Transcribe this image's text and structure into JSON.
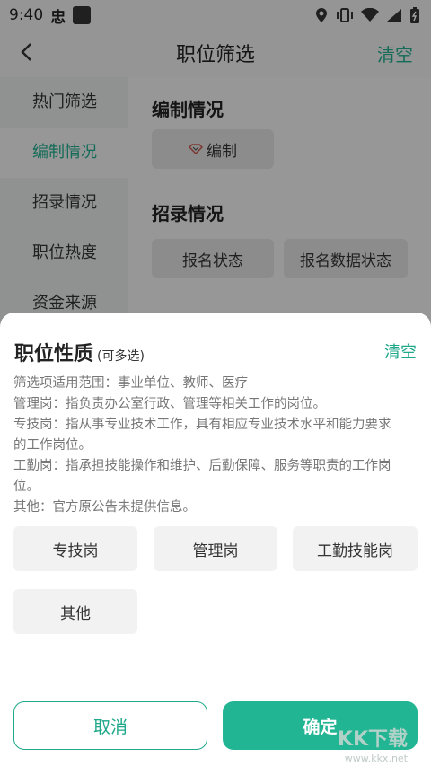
{
  "status": {
    "time": "9:40",
    "app_icon_char": "忠"
  },
  "nav": {
    "title": "职位筛选",
    "clear": "清空"
  },
  "sidebar": {
    "items": [
      {
        "label": "热门筛选"
      },
      {
        "label": "编制情况"
      },
      {
        "label": "招录情况"
      },
      {
        "label": "职位热度"
      },
      {
        "label": "资金来源"
      }
    ]
  },
  "content": {
    "section1_title": "编制情况",
    "chip_bianzhi": "编制",
    "section2_title": "招录情况",
    "chip_status": "报名状态",
    "chip_data_status": "报名数据状态"
  },
  "sheet": {
    "title": "职位性质",
    "subtitle": "(可多选)",
    "clear": "清空",
    "desc": [
      "筛选项适用范围：事业单位、教师、医疗",
      "管理岗：指负责办公室行政、管理等相关工作的岗位。",
      "专技岗：指从事专业技术工作，具有相应专业技术水平和能力要求",
      "的工作岗位。",
      "工勤岗：指承担技能操作和维护、后勤保障、服务等职责的工作岗",
      "位。",
      "其他：官方原公告未提供信息。"
    ],
    "options": [
      "专技岗",
      "管理岗",
      "工勤技能岗",
      "其他"
    ],
    "cancel": "取消",
    "confirm": "确定"
  },
  "watermark": {
    "main": "KK下载",
    "sub": "www.kkx.net"
  },
  "colors": {
    "accent": "#1fa88a",
    "confirm_bg": "#22b593"
  }
}
